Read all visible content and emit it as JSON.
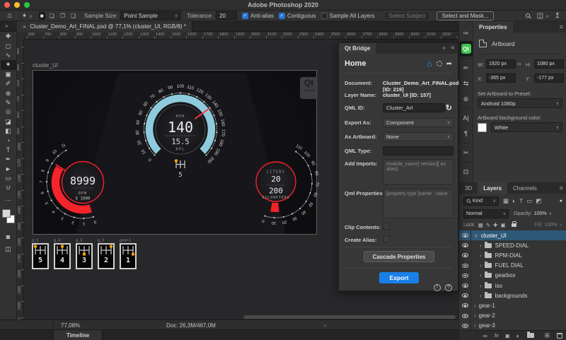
{
  "colors": {
    "accent_blue": "#1a7fe8",
    "qt_green": "#41cd52",
    "gauge_teal": "#8ecbdc",
    "gauge_red": "#f5232b",
    "gauge_orange": "#ffa000",
    "selected_layer": "#2e5878"
  },
  "window": {
    "title": "Adobe Photoshop 2020"
  },
  "tool_options": {
    "sample_size_label": "Sample Size:",
    "sample_size_value": "Point Sample",
    "tolerance_label": "Tolerance:",
    "tolerance_value": "20",
    "checkboxes": [
      {
        "label": "Anti-alias",
        "checked": true
      },
      {
        "label": "Contiguous",
        "checked": true
      },
      {
        "label": "Sample All Layers",
        "checked": false
      }
    ],
    "select_subject_label": "Select Subject",
    "select_and_mask_label": "Select and Mask...",
    "mode_icons": [
      {
        "name": "new-selection-icon",
        "glyph": "■",
        "active": true
      },
      {
        "name": "add-selection-icon",
        "glyph": "❏",
        "active": false
      },
      {
        "name": "subtract-selection-icon",
        "glyph": "❐",
        "active": false
      },
      {
        "name": "intersect-selection-icon",
        "glyph": "❑",
        "active": false
      }
    ]
  },
  "document_tab": {
    "close": "×",
    "title": "Cluster_Demo_Art_FINAL.psd @ 77,1% (cluster_UI, RGB/8) *"
  },
  "rulers": {
    "h_start": 600,
    "h_end": 3300,
    "v_start": 400,
    "v_end": 2100,
    "step": 100
  },
  "tool_palette": [
    {
      "name": "move-tool",
      "glyph": "✚",
      "active": false
    },
    {
      "name": "marquee-tool",
      "glyph": "◻",
      "active": false
    },
    {
      "name": "lasso-tool",
      "glyph": "∿",
      "active": false
    },
    {
      "name": "magic-wand-tool",
      "glyph": "✶",
      "active": true
    },
    {
      "name": "crop-tool",
      "glyph": "▣",
      "active": false
    },
    {
      "name": "eyedropper-tool",
      "glyph": "✐",
      "active": false
    },
    {
      "name": "healing-brush-tool",
      "glyph": "⊕",
      "active": false
    },
    {
      "name": "brush-tool",
      "glyph": "✎",
      "active": false
    },
    {
      "name": "clone-stamp-tool",
      "glyph": "⊙",
      "active": false
    },
    {
      "name": "eraser-tool",
      "glyph": "◪",
      "active": false
    },
    {
      "name": "gradient-tool",
      "glyph": "◧",
      "active": false
    },
    {
      "name": "blur-tool",
      "glyph": "◔",
      "active": false
    },
    {
      "name": "type-tool",
      "glyph": "T",
      "active": false
    },
    {
      "name": "pen-tool",
      "glyph": "✒",
      "active": false
    },
    {
      "name": "path-selection-tool",
      "glyph": "►",
      "active": false
    },
    {
      "name": "rectangle-tool",
      "glyph": "▭",
      "active": false
    },
    {
      "name": "hand-tool",
      "glyph": "∪",
      "active": false
    }
  ],
  "toolbar_extras": {
    "edit_toolbar": "⋯",
    "quick_mask": "◙",
    "screen_mode": "◫"
  },
  "right_strip": [
    {
      "name": "clone-source-panel-icon",
      "glyph": "✑",
      "qt": false,
      "divider_after": false
    },
    {
      "name": "qt-bridge-panel-icon",
      "glyph": "Qt",
      "qt": true,
      "divider_after": true
    },
    {
      "name": "brush-settings-panel-icon",
      "glyph": "✏",
      "qt": false,
      "divider_after": false
    },
    {
      "name": "properties-sliders-panel-icon",
      "glyph": "⇆",
      "qt": false,
      "divider_after": false
    },
    {
      "name": "clone-stamp-panel-icon",
      "glyph": "⊛",
      "qt": false,
      "divider_after": true
    },
    {
      "name": "character-panel-icon",
      "glyph": "A|",
      "qt": false,
      "divider_after": false
    },
    {
      "name": "paragraph-panel-icon",
      "glyph": "¶",
      "qt": false,
      "divider_after": true
    },
    {
      "name": "tool-presets-panel-icon",
      "glyph": "✂",
      "qt": false,
      "divider_after": true
    },
    {
      "name": "libraries-panel-icon",
      "glyph": "⊡",
      "qt": false,
      "divider_after": false
    }
  ],
  "cluster": {
    "artboard_name": "cluster_UI",
    "badge_title": "Qt",
    "badge_subtitle": "Built with",
    "speed_gauge": {
      "unit": "KPH",
      "value": "140",
      "economy": "15.5",
      "economy_unit": "KPL",
      "max": 200,
      "needle_value": 140,
      "gear": "5",
      "ticks": [
        0,
        10,
        20,
        30,
        40,
        50,
        60,
        70,
        80,
        90,
        100,
        110,
        120,
        130,
        140,
        150,
        160,
        170,
        180,
        190,
        200
      ]
    },
    "rpm_gauge": {
      "value": "8999",
      "label": "RPM",
      "multiplier": "X 1000",
      "max": 11,
      "level": 9,
      "ticks": [
        0,
        1,
        2,
        3,
        4,
        5,
        6,
        7,
        8,
        9,
        10,
        11
      ]
    },
    "fuel_gauge": {
      "top_label": "LITERS",
      "liters": "20",
      "range": "200",
      "range_label": "KILOMETERS",
      "max": 110,
      "level_from": 5,
      "level_to": 16,
      "ticks": [
        0,
        10,
        20,
        30,
        40,
        50,
        60,
        70,
        80,
        90,
        100,
        110
      ]
    },
    "gears": [
      {
        "label": "g_5",
        "number": "5",
        "col": 0,
        "row": 0
      },
      {
        "label": "g_4",
        "number": "4",
        "col": 1,
        "row": 0
      },
      {
        "label": "g_3",
        "number": "3",
        "col": 1,
        "row": 1
      },
      {
        "label": "g_2",
        "number": "2",
        "col": 2,
        "row": 0
      },
      {
        "label": "gear-1",
        "number": "1",
        "col": 2,
        "row": 1
      }
    ]
  },
  "qt_bridge": {
    "panel_title": "Qt Bridge",
    "home_title": "Home",
    "document_label": "Document:",
    "document_value": "Cluster_Demo_Art_FINAL.psd [ID: 219]",
    "layer_name_label": "Layer Name:",
    "layer_name_value": "cluster_UI [ID: 157]",
    "qml_id_label": "QML ID:",
    "qml_id_value": "Cluster_Art",
    "export_as_label": "Export As:",
    "export_as_value": "Component",
    "as_artboard_label": "As Artboard:",
    "as_artboard_value": "None",
    "qml_type_label": "QML Type:",
    "add_imports_label": "Add Imports:",
    "add_imports_placeholder": "module_name[ version][ as alias]",
    "qml_properties_label": "Qml Properties:",
    "qml_properties_placeholder": "[property type ]name : value",
    "clip_contents_label": "Clip Contents:",
    "create_alias_label": "Create Alias:",
    "cascade_button": "Cascade Properties",
    "export_button": "Export"
  },
  "properties_panel": {
    "tab": "Properties",
    "type_label": "Artboard",
    "w_label": "W:",
    "w_value": "1920 px",
    "h_label": "H:",
    "h_value": "1080 px",
    "x_label": "X:",
    "x_value": "-365 px",
    "y_label": "Y:",
    "y_value": "-177 px",
    "preset_label": "Set Artboard to Preset:",
    "preset_value": "Android 1080p",
    "bg_label": "Artboard background color:",
    "bg_value": "White"
  },
  "layers_panel": {
    "tabs": [
      "3D",
      "Layers",
      "Channels"
    ],
    "active_tab": "Layers",
    "kind_label": "Kind",
    "filter_icons": [
      {
        "name": "filter-pixel-layers-icon",
        "glyph": "▦"
      },
      {
        "name": "filter-adjustment-layers-icon",
        "glyph": "◐"
      },
      {
        "name": "filter-type-layers-icon",
        "glyph": "T"
      },
      {
        "name": "filter-shape-layers-icon",
        "glyph": "▭"
      },
      {
        "name": "filter-smart-objects-icon",
        "glyph": "◩"
      }
    ],
    "blend_mode": "Normal",
    "opacity_label": "Opacity:",
    "opacity_value": "100%",
    "lock_label": "Lock:",
    "lock_icons": [
      {
        "name": "lock-transparent-pixels-icon",
        "glyph": "▦"
      },
      {
        "name": "lock-image-pixels-icon",
        "glyph": "✎"
      },
      {
        "name": "lock-position-icon",
        "glyph": "✚"
      },
      {
        "name": "lock-artboard-icon",
        "glyph": "▣"
      }
    ],
    "fill_label": "Fill:",
    "fill_value": "100%",
    "rows": [
      {
        "name": "cluster_UI",
        "indent": 0,
        "expanded": true,
        "folder": false,
        "selected": true
      },
      {
        "name": "SPEED-DIAL",
        "indent": 1,
        "expanded": false,
        "folder": true,
        "selected": false
      },
      {
        "name": "RPM-DIAL",
        "indent": 1,
        "expanded": false,
        "folder": true,
        "selected": false
      },
      {
        "name": "FUEL DIAL",
        "indent": 1,
        "expanded": false,
        "folder": true,
        "selected": false
      },
      {
        "name": "gearbox",
        "indent": 1,
        "expanded": false,
        "folder": true,
        "selected": false
      },
      {
        "name": "iso",
        "indent": 1,
        "expanded": false,
        "folder": true,
        "selected": false
      },
      {
        "name": "backgrounds",
        "indent": 1,
        "expanded": false,
        "folder": true,
        "selected": false
      },
      {
        "name": "gear-1",
        "indent": 0,
        "expanded": false,
        "folder": false,
        "selected": false
      },
      {
        "name": "gear-2",
        "indent": 0,
        "expanded": false,
        "folder": false,
        "selected": false
      },
      {
        "name": "gear-3",
        "indent": 0,
        "expanded": false,
        "folder": false,
        "selected": false
      }
    ],
    "bottom_icons": [
      {
        "name": "link-layers-icon",
        "glyph": "∞"
      },
      {
        "name": "layer-effects-icon",
        "glyph": "fx"
      },
      {
        "name": "layer-mask-icon",
        "glyph": "◙"
      },
      {
        "name": "adjustment-layer-icon",
        "glyph": "◐"
      },
      {
        "name": "new-group-icon",
        "glyph": "folder"
      },
      {
        "name": "new-layer-icon",
        "glyph": "⊞"
      },
      {
        "name": "delete-layer-icon",
        "glyph": "trash"
      }
    ]
  },
  "status_bar": {
    "zoom_value": "77,08%",
    "doc_info": "Doc: 26,3M/467,0M"
  },
  "timeline": {
    "tab_label": "Timeline"
  }
}
